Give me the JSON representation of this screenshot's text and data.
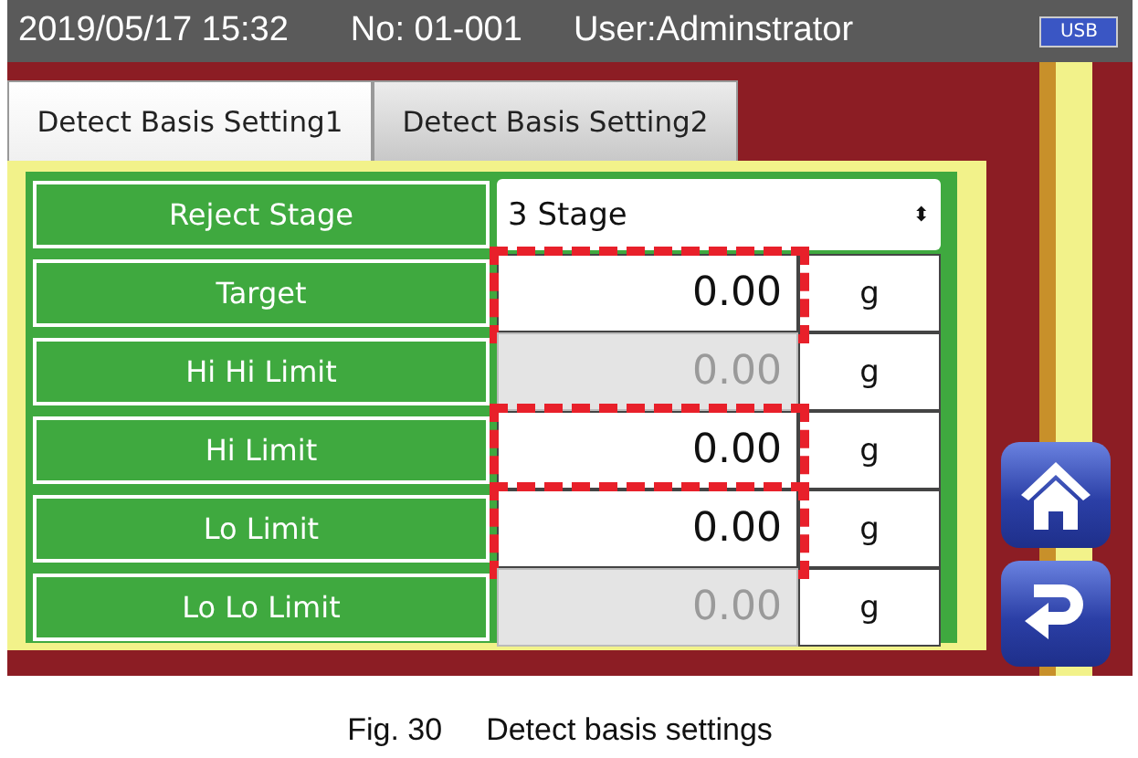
{
  "status_bar": {
    "datetime": "2019/05/17 15:32",
    "number": "No:  01-001",
    "user": "User:Adminstrator",
    "usb": "USB"
  },
  "tabs": [
    {
      "label": "Detect Basis Setting1",
      "selected": true
    },
    {
      "label": "Detect Basis Setting2",
      "selected": false
    }
  ],
  "rows": [
    {
      "kind": "select",
      "label": "Reject Stage",
      "value": "3 Stage",
      "arrow": "⬍",
      "highlighted": false
    },
    {
      "kind": "number",
      "label": "Target",
      "value": "0.00",
      "unit": "g",
      "disabled": false,
      "highlighted": true
    },
    {
      "kind": "number",
      "label": "Hi Hi Limit",
      "value": "0.00",
      "unit": "g",
      "disabled": true,
      "highlighted": false
    },
    {
      "kind": "number",
      "label": "Hi Limit",
      "value": "0.00",
      "unit": "g",
      "disabled": false,
      "highlighted": true
    },
    {
      "kind": "number",
      "label": "Lo Limit",
      "value": "0.00",
      "unit": "g",
      "disabled": false,
      "highlighted": true
    },
    {
      "kind": "number",
      "label": "Lo Lo Limit",
      "value": "0.00",
      "unit": "g",
      "disabled": true,
      "highlighted": false
    }
  ],
  "caption": {
    "number": "Fig. 30",
    "text": "Detect basis settings"
  }
}
